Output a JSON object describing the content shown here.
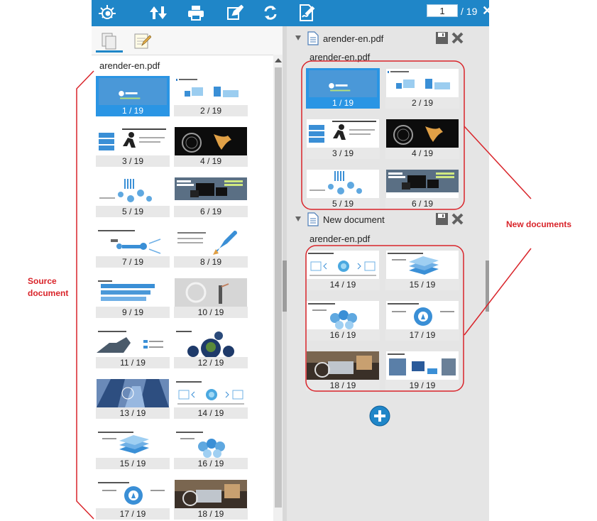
{
  "toolbar": {
    "icons": [
      "logo-sun-icon",
      "sort-updown-icon",
      "print-icon",
      "annotate-pencil-icon",
      "rotate-icon",
      "sign-document-icon"
    ],
    "current_page": "1",
    "total_pages": "/ 19"
  },
  "left_panel": {
    "tabs": [
      "pages-tab-icon",
      "notes-tab-icon"
    ],
    "document_title": "arender-en.pdf",
    "thumbnails": [
      {
        "label": "1 / 19",
        "selected": true
      },
      {
        "label": "2 / 19"
      },
      {
        "label": "3 / 19"
      },
      {
        "label": "4 / 19"
      },
      {
        "label": "5 / 19"
      },
      {
        "label": "6 / 19"
      },
      {
        "label": "7 / 19"
      },
      {
        "label": "8 / 19"
      },
      {
        "label": "9 / 19"
      },
      {
        "label": "10 / 19"
      },
      {
        "label": "11 / 19"
      },
      {
        "label": "12 / 19"
      },
      {
        "label": "13 / 19"
      },
      {
        "label": "14 / 19"
      },
      {
        "label": "15 / 19"
      },
      {
        "label": "16 / 19"
      },
      {
        "label": "17 / 19"
      },
      {
        "label": "18 / 19"
      }
    ]
  },
  "right_panel": {
    "documents": [
      {
        "name": "arender-en.pdf",
        "source": "arender-en.pdf",
        "thumbnails": [
          {
            "label": "1 / 19",
            "selected": true
          },
          {
            "label": "2 / 19"
          },
          {
            "label": "3 / 19"
          },
          {
            "label": "4 / 19"
          },
          {
            "label": "5 / 19"
          },
          {
            "label": "6 / 19"
          }
        ]
      },
      {
        "name": "New document",
        "source": "arender-en.pdf",
        "thumbnails": [
          {
            "label": "14 / 19"
          },
          {
            "label": "15 / 19"
          },
          {
            "label": "16 / 19"
          },
          {
            "label": "17 / 19"
          },
          {
            "label": "18 / 19"
          },
          {
            "label": "19 / 19"
          }
        ]
      }
    ]
  },
  "annotations": {
    "source_document": "Source document",
    "new_documents": "New documents",
    "color": "#d9242a"
  },
  "colors": {
    "toolbar": "#1f86c8",
    "selection": "#2a95e4"
  }
}
